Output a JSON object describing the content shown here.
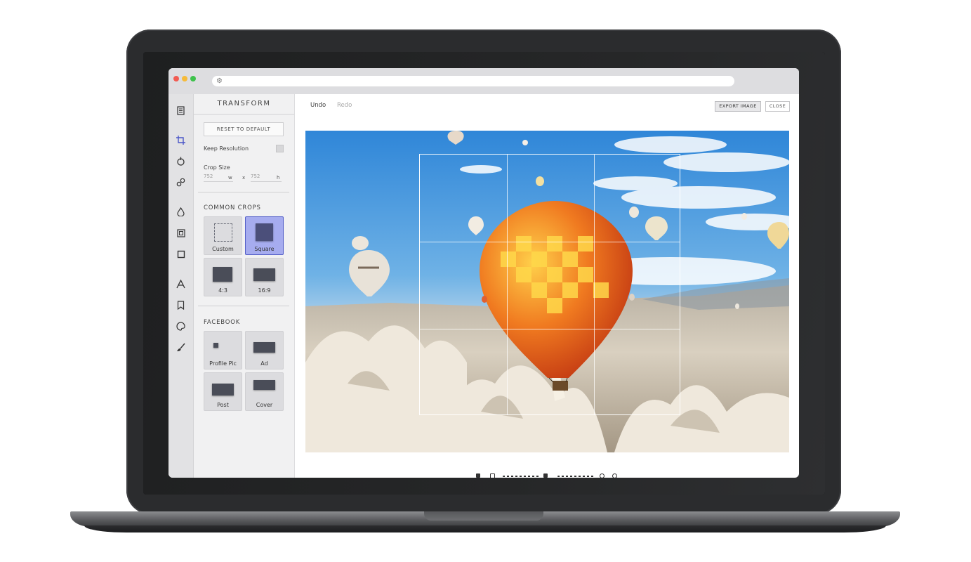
{
  "toolbar": {
    "undo": "Undo",
    "redo": "Redo",
    "export": "EXPORT IMAGE",
    "close": "CLOSE"
  },
  "panel": {
    "title": "TRANSFORM",
    "reset": "RESET TO DEFAULT",
    "keep_resolution": "Keep Resolution",
    "crop_size": "Crop Size",
    "width_value": "752",
    "width_unit": "w",
    "separator": "x",
    "height_value": "752",
    "height_unit": "h",
    "common_crops": {
      "title": "COMMON CROPS",
      "items": [
        {
          "label": "Custom"
        },
        {
          "label": "Square",
          "selected": true
        },
        {
          "label": "4:3"
        },
        {
          "label": "16:9"
        }
      ]
    },
    "facebook": {
      "title": "FACEBOOK",
      "items": [
        {
          "label": "Profile Pic"
        },
        {
          "label": "Ad"
        },
        {
          "label": "Post"
        },
        {
          "label": "Cover"
        }
      ]
    }
  },
  "iconbar": [
    "document-icon",
    "crop-icon",
    "filter-icon",
    "adjust-icon",
    "drop-icon",
    "frame-icon",
    "square-icon",
    "text-icon",
    "bookmark-icon",
    "palette-icon",
    "brush-icon"
  ],
  "colors": {
    "accent": "#4b56c8",
    "selected_tile": "#a6acef"
  }
}
